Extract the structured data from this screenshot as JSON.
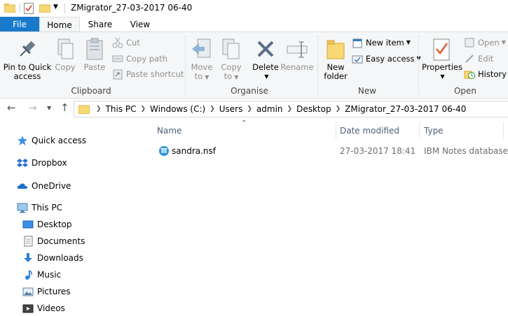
{
  "window": {
    "title": "ZMigrator_27-03-2017 06-40"
  },
  "tabs": {
    "file": "File",
    "home": "Home",
    "share": "Share",
    "view": "View"
  },
  "ribbon": {
    "clipboard": {
      "group_label": "Clipboard",
      "pin_quick_access_1": "Pin to Quick",
      "pin_quick_access_2": "access",
      "copy": "Copy",
      "paste": "Paste",
      "cut": "Cut",
      "copy_path": "Copy path",
      "paste_shortcut": "Paste shortcut"
    },
    "organise": {
      "group_label": "Organise",
      "move_to_1": "Move",
      "move_to_2": "to",
      "copy_to_1": "Copy",
      "copy_to_2": "to",
      "delete": "Delete",
      "rename": "Rename"
    },
    "new": {
      "group_label": "New",
      "new_folder_1": "New",
      "new_folder_2": "folder",
      "new_item": "New item",
      "easy_access": "Easy access"
    },
    "open": {
      "group_label": "Open",
      "properties": "Properties",
      "open": "Open",
      "edit": "Edit",
      "history": "History"
    }
  },
  "address": {
    "crumbs": [
      "This PC",
      "Windows (C:)",
      "Users",
      "admin",
      "Desktop",
      "ZMigrator_27-03-2017 06-40"
    ]
  },
  "nav": {
    "quick_access": "Quick access",
    "dropbox": "Dropbox",
    "onedrive": "OneDrive",
    "this_pc": "This PC",
    "desktop": "Desktop",
    "documents": "Documents",
    "downloads": "Downloads",
    "music": "Music",
    "pictures": "Pictures",
    "videos": "Videos"
  },
  "columns": {
    "name": "Name",
    "date_modified": "Date modified",
    "type": "Type"
  },
  "files": [
    {
      "name": "sandra.nsf",
      "date_modified": "27-03-2017 18:41",
      "type": "IBM Notes database"
    }
  ],
  "colors": {
    "accent": "#1979ca",
    "folder": "#f8d775",
    "delete_x": "#5a6f88"
  }
}
